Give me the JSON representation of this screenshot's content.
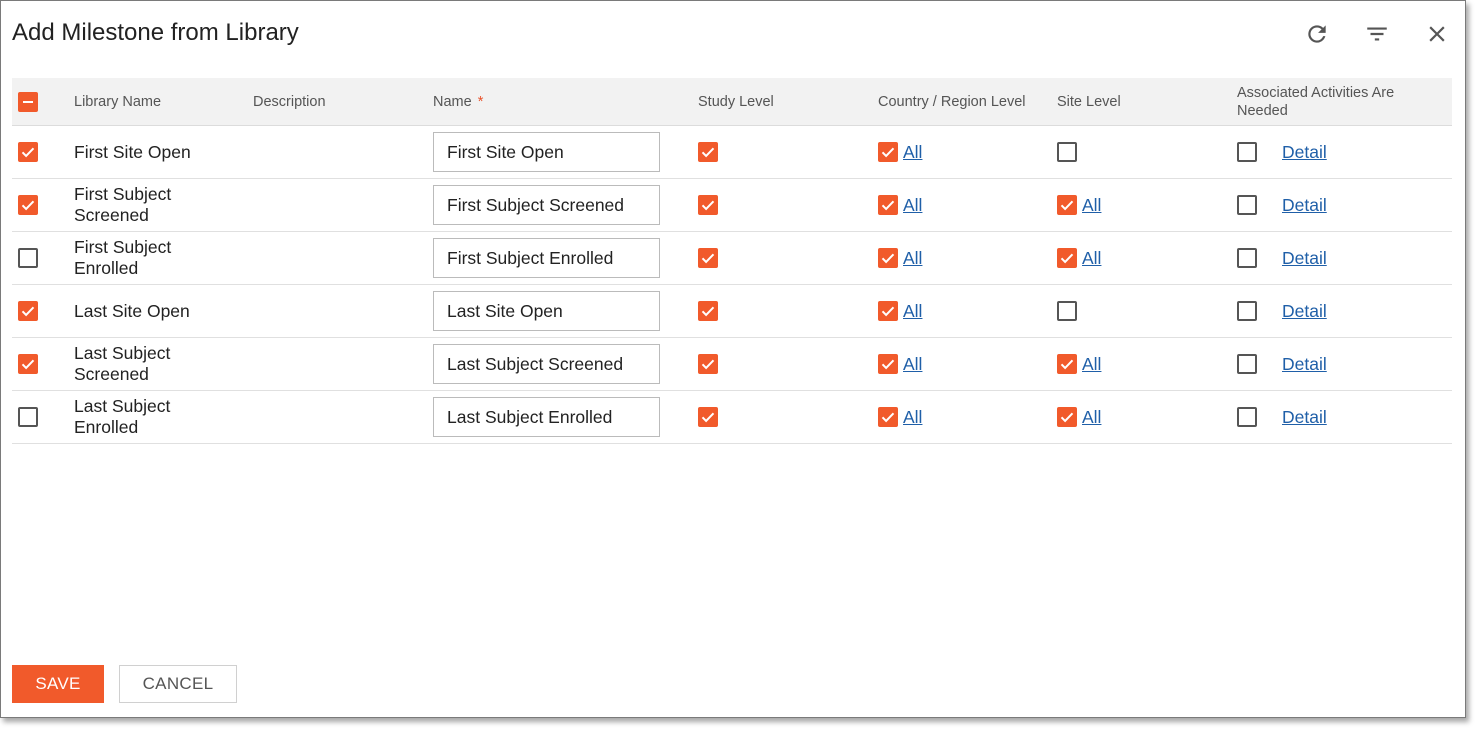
{
  "dialog": {
    "title": "Add Milestone from Library"
  },
  "header_icons": [
    "refresh-icon",
    "filter-icon",
    "close-icon"
  ],
  "colors": {
    "accent": "#f15a2b",
    "link": "#1f5fa8",
    "header_bg": "#f2f2f2"
  },
  "table": {
    "columns": {
      "library_name": "Library Name",
      "description": "Description",
      "name": "Name",
      "required_marker": "*",
      "study_level": "Study Level",
      "country_region_level": "Country / Region Level",
      "site_level": "Site Level",
      "associated_activities": "Associated Activities Are Needed"
    },
    "select_all_state": "indeterminate",
    "rows": [
      {
        "selected": true,
        "library_name": "First Site Open",
        "description": "",
        "name": "First Site Open",
        "study_level": true,
        "country_level": true,
        "country_link": "All",
        "site_level": false,
        "site_link": "",
        "activities_needed": false,
        "detail_link": "Detail"
      },
      {
        "selected": true,
        "library_name": "First Subject Screened",
        "description": "",
        "name": "First Subject Screened",
        "study_level": true,
        "country_level": true,
        "country_link": "All",
        "site_level": true,
        "site_link": "All",
        "activities_needed": false,
        "detail_link": "Detail"
      },
      {
        "selected": false,
        "library_name": "First Subject Enrolled",
        "description": "",
        "name": "First Subject Enrolled",
        "study_level": true,
        "country_level": true,
        "country_link": "All",
        "site_level": true,
        "site_link": "All",
        "activities_needed": false,
        "detail_link": "Detail"
      },
      {
        "selected": true,
        "library_name": "Last Site Open",
        "description": "",
        "name": "Last Site Open",
        "study_level": true,
        "country_level": true,
        "country_link": "All",
        "site_level": false,
        "site_link": "",
        "activities_needed": false,
        "detail_link": "Detail"
      },
      {
        "selected": true,
        "library_name": "Last Subject Screened",
        "description": "",
        "name": "Last Subject Screened",
        "study_level": true,
        "country_level": true,
        "country_link": "All",
        "site_level": true,
        "site_link": "All",
        "activities_needed": false,
        "detail_link": "Detail"
      },
      {
        "selected": false,
        "library_name": "Last Subject Enrolled",
        "description": "",
        "name": "Last Subject Enrolled",
        "study_level": true,
        "country_level": true,
        "country_link": "All",
        "site_level": true,
        "site_link": "All",
        "activities_needed": false,
        "detail_link": "Detail"
      }
    ]
  },
  "footer": {
    "save_label": "SAVE",
    "cancel_label": "CANCEL"
  }
}
